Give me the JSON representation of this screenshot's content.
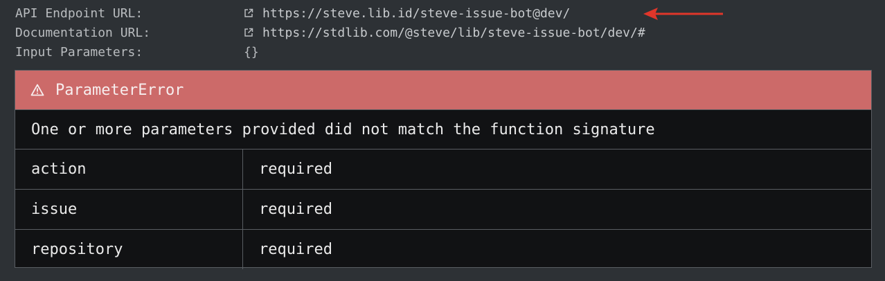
{
  "meta": {
    "api_endpoint": {
      "label": "API Endpoint URL:",
      "value": "https://steve.lib.id/steve-issue-bot@dev/"
    },
    "documentation": {
      "label": "Documentation URL:",
      "value": "https://stdlib.com/@steve/lib/steve-issue-bot/dev/#"
    },
    "input_parameters": {
      "label": "Input Parameters:",
      "value": "{}"
    }
  },
  "error": {
    "title": "ParameterError",
    "message": "One or more parameters provided did not match the function signature",
    "params": [
      {
        "name": "action",
        "status": "required"
      },
      {
        "name": "issue",
        "status": "required"
      },
      {
        "name": "repository",
        "status": "required"
      }
    ]
  },
  "colors": {
    "background": "#2d3135",
    "error_header": "#cc6a69",
    "panel": "#111214",
    "annotation_arrow": "#e0362a"
  },
  "icons": {
    "link": "external-link-icon",
    "warning": "warning-icon",
    "annotation": "red-arrow-icon"
  }
}
